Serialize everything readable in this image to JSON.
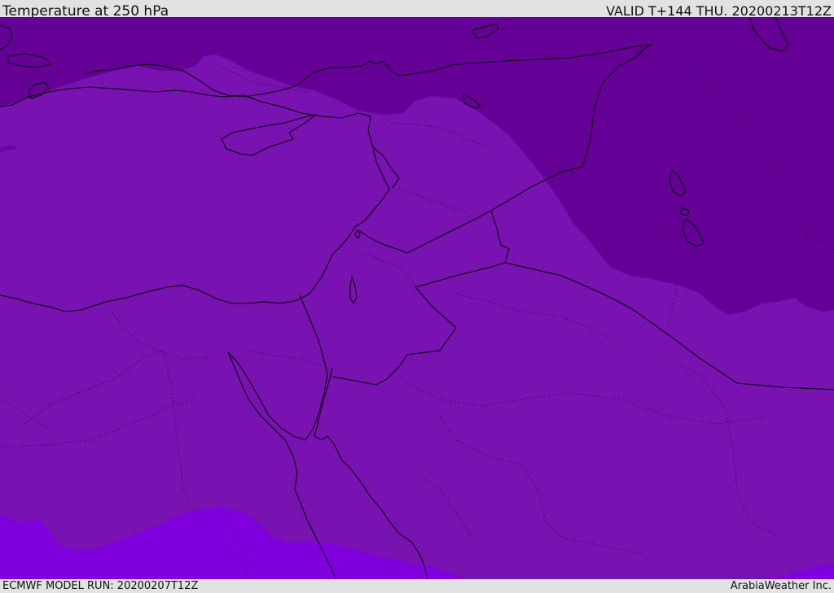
{
  "header": {
    "title": "Temperature at 250 hPa",
    "valid": "VALID T+144 THU. 20200213T12Z"
  },
  "footer": {
    "model_run": "ECMWF MODEL RUN: 20200207T12Z",
    "credit": "ArabiaWeather Inc."
  },
  "map": {
    "fill_colors": {
      "coldest": "#640096",
      "middle": "#7812b0",
      "warmest": "#7f00dc"
    },
    "line_color": "#000000"
  }
}
